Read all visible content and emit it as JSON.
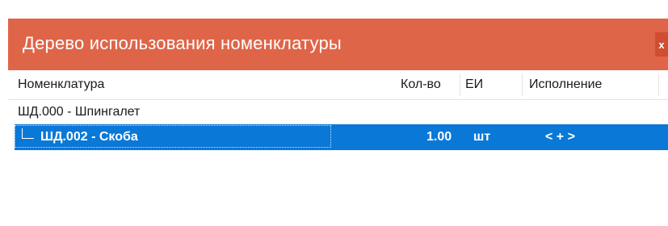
{
  "window": {
    "title": "Дерево использования номенклатуры",
    "close_label": "x"
  },
  "columns": {
    "nomenclature": "Номенклатура",
    "qty": "Кол-во",
    "unit": "ЕИ",
    "variant": "Исполнение"
  },
  "rows": [
    {
      "name": "ШД.000 - Шпингалет",
      "qty": "",
      "unit": "",
      "variant": ""
    },
    {
      "name": "ШД.002 - Скоба",
      "qty": "1.00",
      "unit": "шт",
      "variant": "< + >",
      "selected": true
    }
  ],
  "colors": {
    "title_bar": "#df6548",
    "selection": "#0a78d7"
  }
}
